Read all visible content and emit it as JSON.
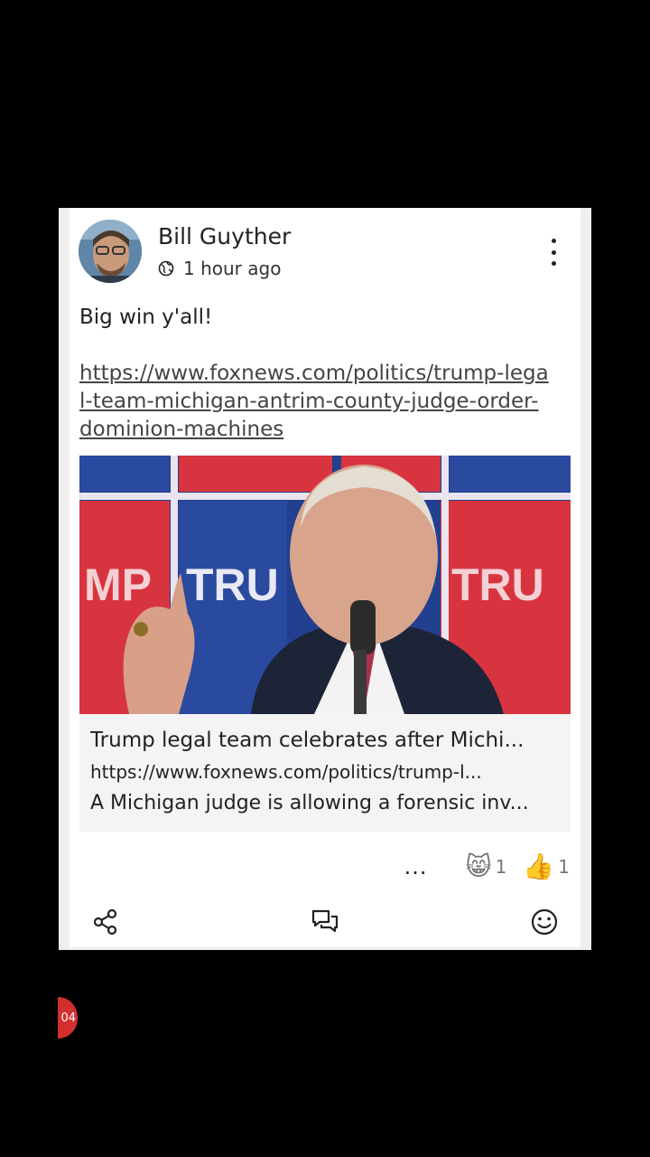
{
  "post": {
    "author": "Bill Guyther",
    "time": "1 hour ago",
    "text": "Big win y'all!",
    "link": "https://www.foxnews.com/politics/trump-legal-team-michigan-antrim-county-judge-order-dominion-machines"
  },
  "preview": {
    "title": "Trump legal team celebrates after Michi...",
    "url": "https://www.foxnews.com/politics/trump-l...",
    "description": "A Michigan judge is allowing a forensic inv..."
  },
  "reactions": {
    "more": "...",
    "items": [
      {
        "icon": "grinning-cat-emoji",
        "glyph": "😸",
        "count": "1"
      },
      {
        "icon": "thumbs-up-emoji",
        "glyph": "👍",
        "count": "1"
      }
    ]
  },
  "notification": {
    "badge": "04"
  }
}
